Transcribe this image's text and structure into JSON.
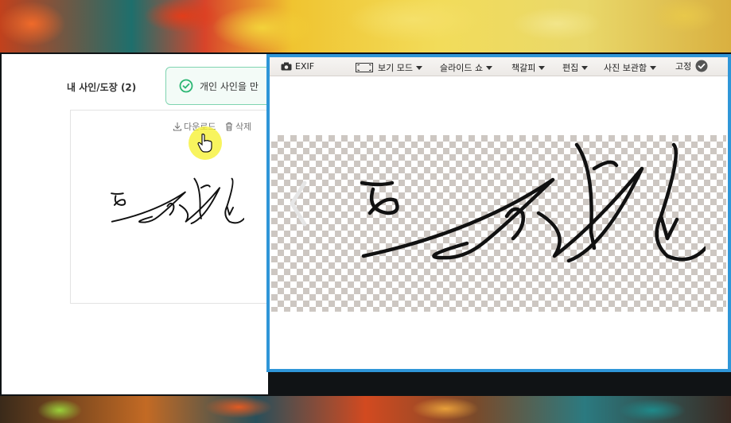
{
  "webpage": {
    "section_title": "내 사인/도장 (2)",
    "toast_text": "개인 사인을 만",
    "download_label": "다운로드",
    "delete_label": "삭제"
  },
  "viewer": {
    "exif_label": "EXIF",
    "menu": {
      "view_mode": "보기 모드",
      "slideshow": "슬라이드 쇼",
      "bookmark": "책갈피",
      "edit": "편집",
      "photo_album": "사진 보관함",
      "pin": "고정"
    }
  },
  "icons": {
    "toast": "check-circle-icon",
    "download": "download-icon",
    "delete": "trash-icon",
    "camera": "camera-icon",
    "view_mode": "view-mode-icon",
    "pin": "check-badge-icon",
    "prev": "chevron-left-icon",
    "cursor": "hand-pointer-icon"
  },
  "colors": {
    "viewer_border": "#2f96d8",
    "toast_accent": "#2bb673",
    "cursor_highlight": "#f5f028"
  }
}
